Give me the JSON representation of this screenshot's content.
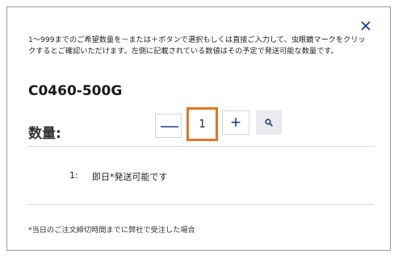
{
  "modal": {
    "close_icon": "close-icon",
    "intro_text": "1〜999までのご希望数量を－または＋ボタンで選択もしくは直接ご入力して、虫眼鏡マークをクリックするとご確認いただけます。左側に記載されている数値はその予定で発送可能な数量です。",
    "part_number": "C0460-500G",
    "quantity_label": "数量:",
    "minus_label": "—",
    "plus_label": "+",
    "quantity_value": "1",
    "search_icon": "search-icon",
    "availability": {
      "quantity": "1:",
      "text": "即日*発送可能です"
    },
    "footnote": "*当日のご注文締切時間までに弊社で受注した場合",
    "colors": {
      "accent": "#1e3f8a",
      "input_border": "#e17624",
      "search_bg": "#e9ebef"
    }
  }
}
